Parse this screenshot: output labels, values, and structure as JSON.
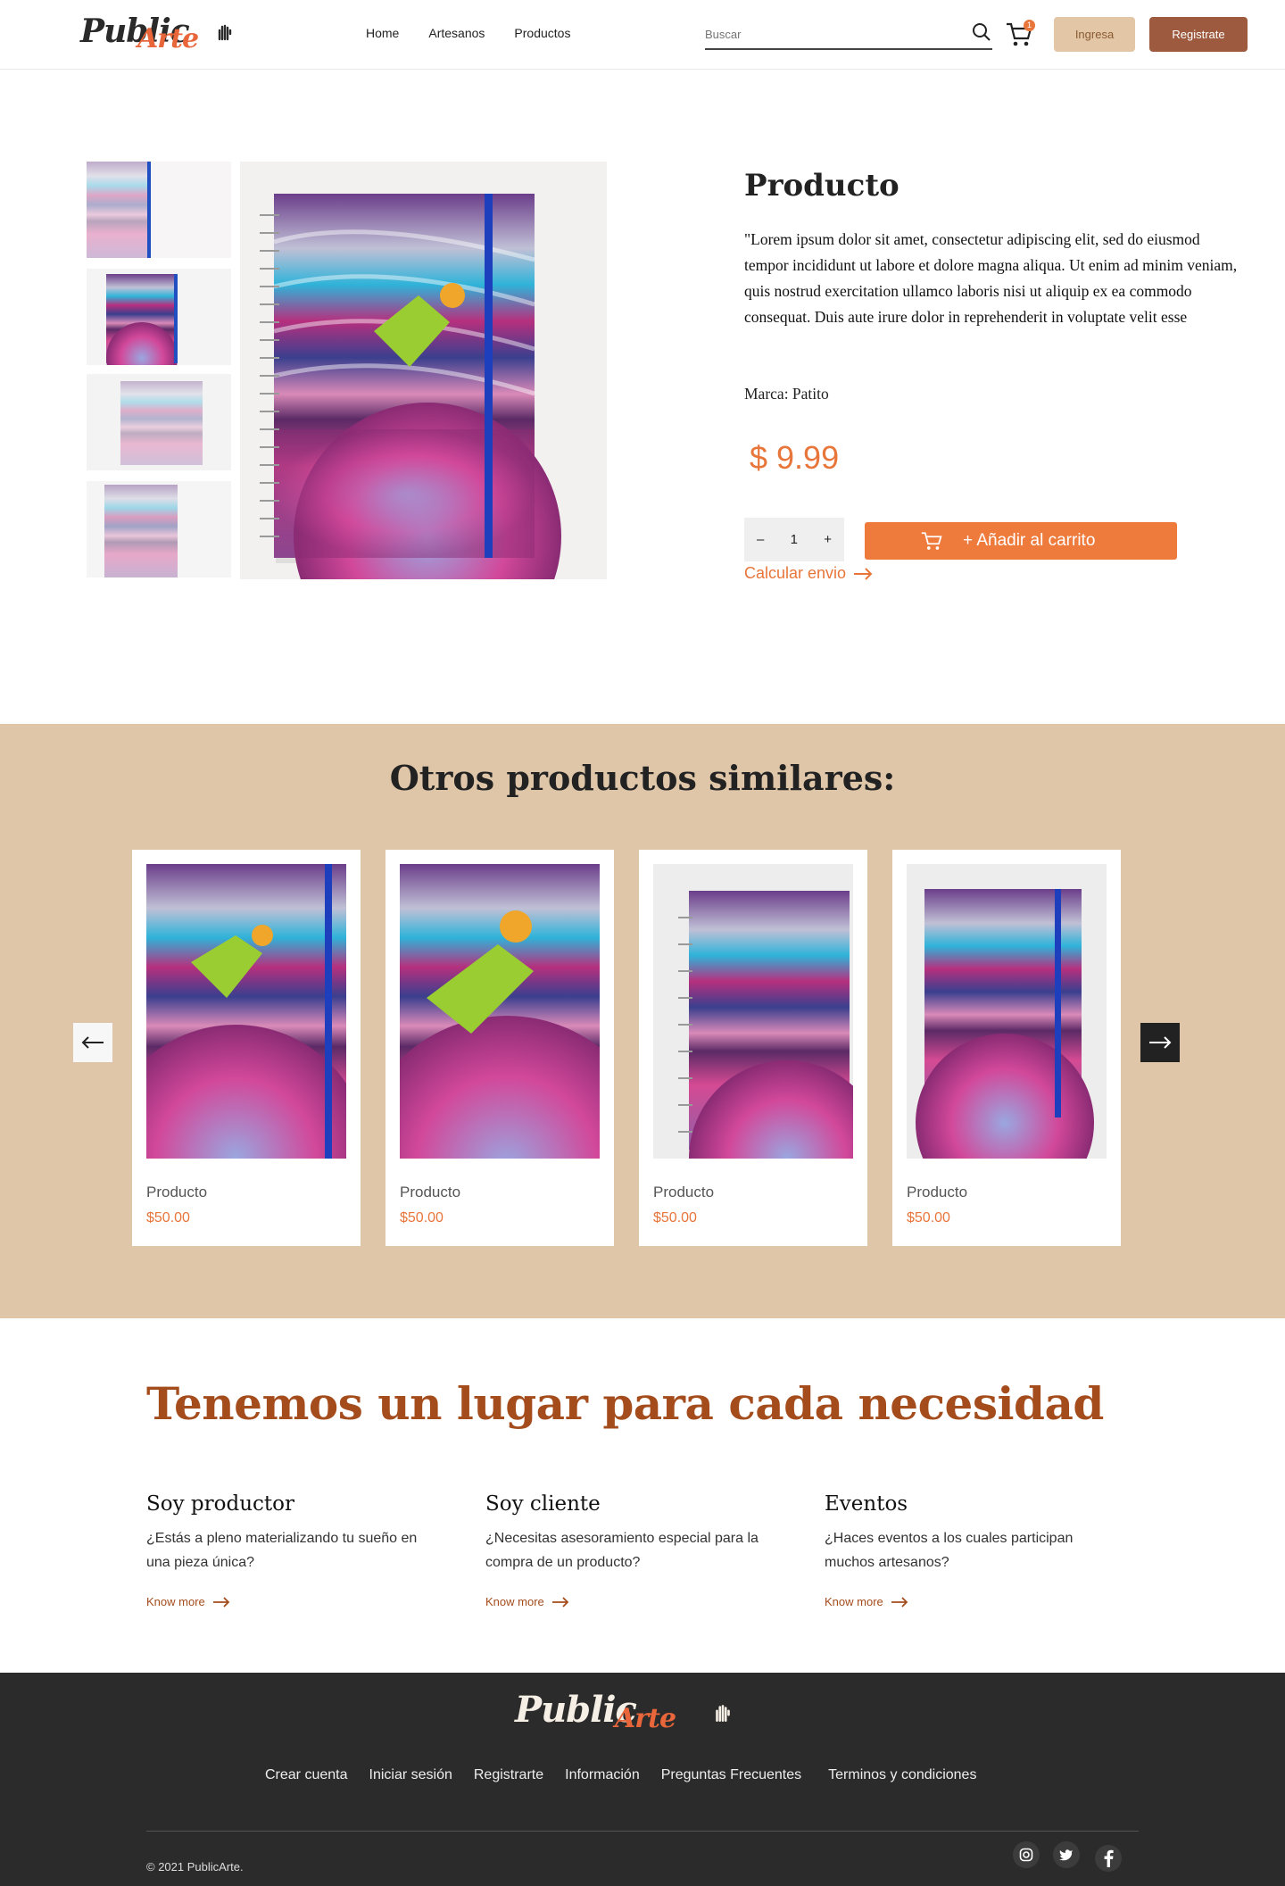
{
  "header": {
    "logo_primary": "Public",
    "logo_secondary": "Arte",
    "nav": [
      "Home",
      "Artesanos",
      "Productos"
    ],
    "search_placeholder": "Buscar",
    "cart_count": "1",
    "login_label": "Ingresa",
    "register_label": "Registrate"
  },
  "product": {
    "title": "Producto",
    "description": "\"Lorem ipsum dolor sit amet, consectetur adipiscing elit, sed do eiusmod tempor incididunt ut labore et dolore magna aliqua. Ut enim ad minim veniam, quis nostrud exercitation ullamco laboris nisi ut aliquip ex ea commodo consequat. Duis aute irure dolor in reprehenderit in voluptate velit esse",
    "brand": "Marca: Patito",
    "price": "$ 9.99",
    "quantity": "1",
    "qty_minus": "–",
    "qty_plus": "+",
    "add_to_cart": "+ Añadir al carrito",
    "shipping_link": "Calcular envio"
  },
  "similar": {
    "title": "Otros productos similares:",
    "items": [
      {
        "name": "Producto",
        "price": "$50.00"
      },
      {
        "name": "Producto",
        "price": "$50.00"
      },
      {
        "name": "Producto",
        "price": "$50.00"
      },
      {
        "name": "Producto",
        "price": "$50.00"
      }
    ]
  },
  "info": {
    "heading": "Tenemos un lugar para cada necesidad",
    "columns": [
      {
        "title": "Soy productor",
        "text": "¿Estás a pleno materializando tu sueño en una pieza única?",
        "link": "Know more"
      },
      {
        "title": "Soy cliente",
        "text": "¿Necesitas asesoramiento especial para la compra de un producto?",
        "link": "Know more"
      },
      {
        "title": "Eventos",
        "text": "¿Haces eventos a los cuales participan muchos artesanos?",
        "link": "Know more"
      }
    ]
  },
  "footer": {
    "links": [
      "Crear cuenta",
      "Iniciar sesión",
      "Registrarte",
      "Información",
      "Preguntas Frecuentes",
      "Terminos y condiciones"
    ],
    "copyright": "© 2021 PublicArte.",
    "social_icons": [
      "instagram-icon",
      "twitter-icon",
      "facebook-icon"
    ]
  },
  "colors": {
    "accent": "#e8753a",
    "brown": "#9d5a3e",
    "tan": "#dfc6a9",
    "heading": "#a44c1c",
    "footer_bg": "#2b2b2b"
  }
}
